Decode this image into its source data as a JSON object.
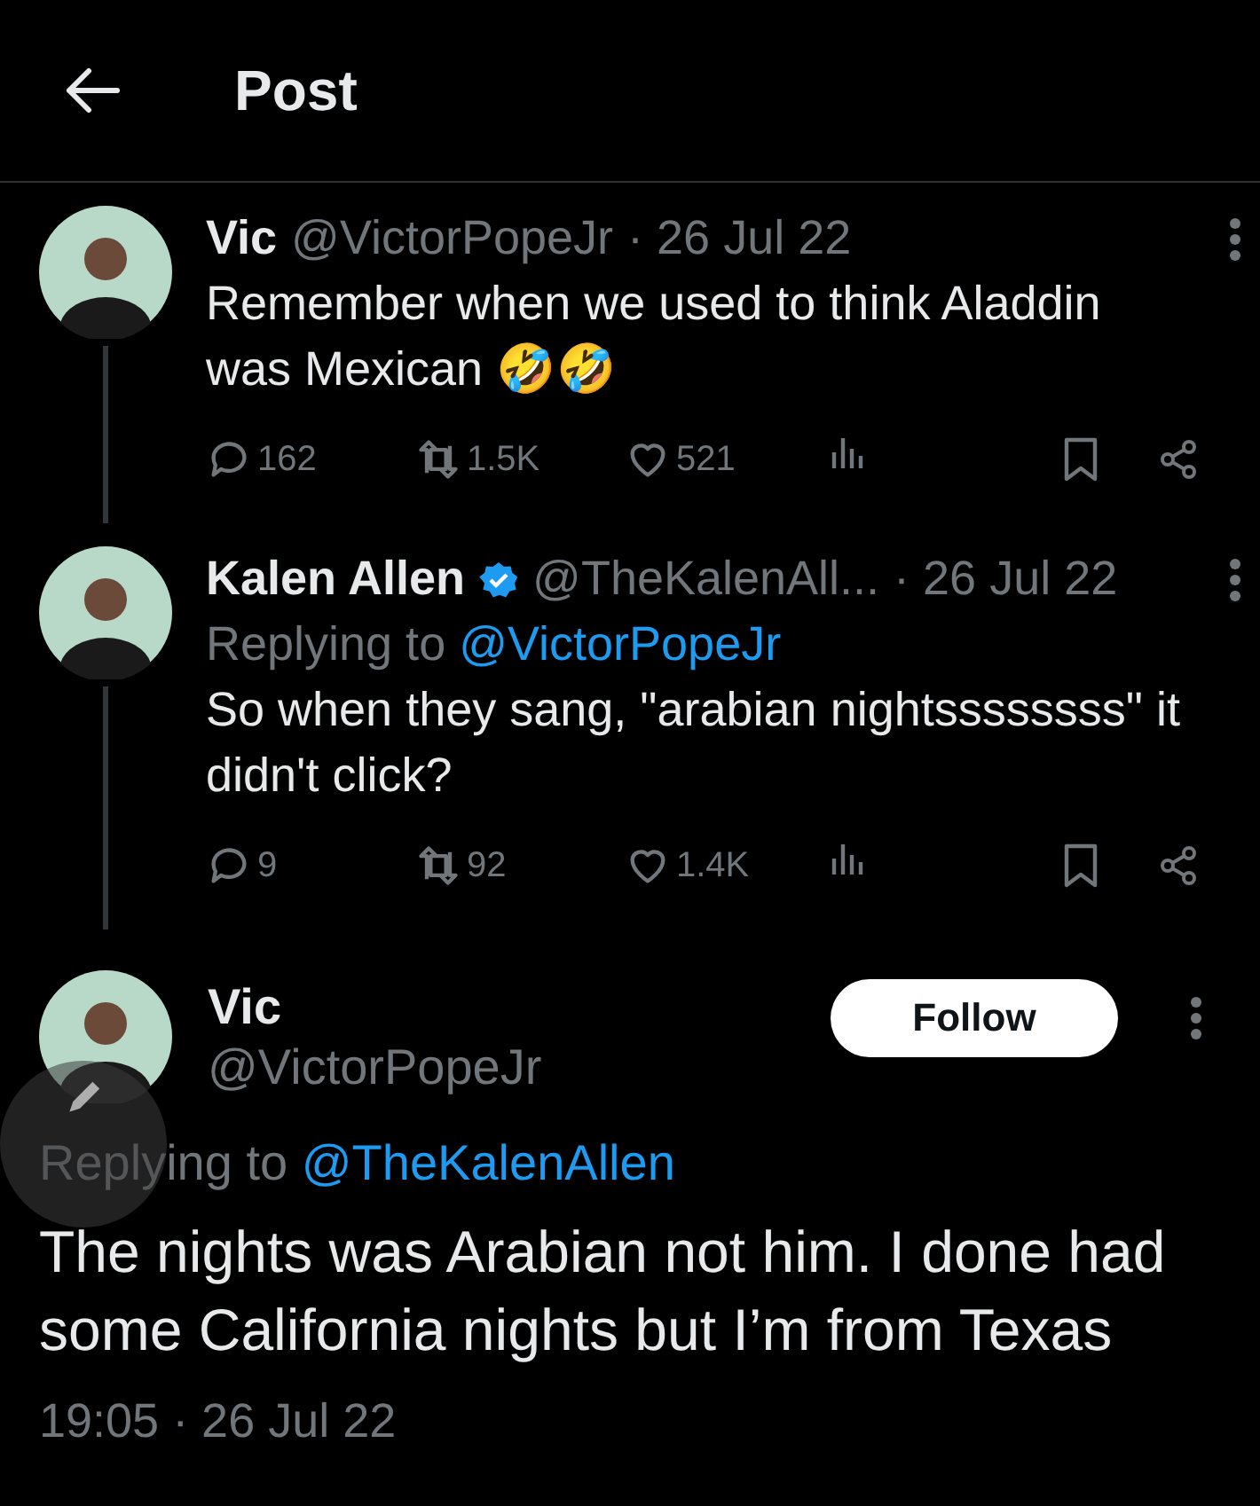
{
  "header": {
    "title": "Post"
  },
  "thread": [
    {
      "name": "Vic",
      "verified": false,
      "handle": "@VictorPopeJr",
      "date": "· 26 Jul 22",
      "text": "Remember when we used to think Aladdin was Mexican 🤣🤣",
      "stats": {
        "replies": "162",
        "reposts": "1.5K",
        "likes": "521"
      }
    },
    {
      "name": "Kalen Allen",
      "verified": true,
      "handle": "@TheKalenAll...",
      "date": "· 26 Jul 22",
      "replying_to": {
        "label": "Replying to",
        "handle": "@VictorPopeJr"
      },
      "text": "So when they sang, \"arabian nightssssssss\" it didn't click?",
      "stats": {
        "replies": "9",
        "reposts": "92",
        "likes": "1.4K"
      }
    }
  ],
  "main_post": {
    "name": "Vic",
    "handle": "@VictorPopeJr",
    "follow_label": "Follow",
    "replying_to": {
      "label": "Replying to",
      "handle": "@TheKalenAllen"
    },
    "text": "The nights was Arabian not him. I done had some California nights but I’m from Texas",
    "timestamp": "19:05 · 26 Jul 22"
  }
}
